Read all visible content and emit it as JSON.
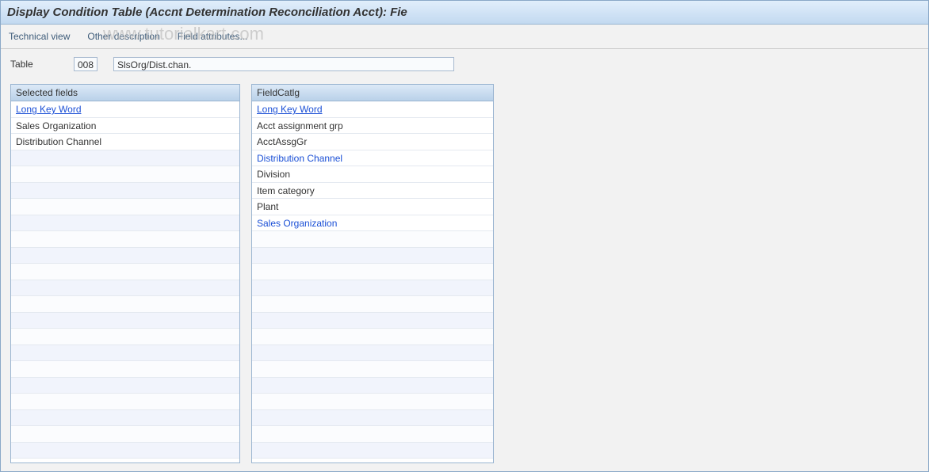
{
  "header": {
    "title": "Display Condition Table (Accnt Determination Reconciliation Acct): Fie"
  },
  "menu": {
    "items": [
      "Technical view",
      "Other description",
      "Field attributes..."
    ]
  },
  "table_field": {
    "label": "Table",
    "code": "008",
    "desc": "SlsOrg/Dist.chan."
  },
  "panels": {
    "selected": {
      "title": "Selected fields",
      "header_row": "Long Key Word",
      "rows": [
        "Sales Organization",
        "Distribution Channel"
      ]
    },
    "catalog": {
      "title": "FieldCatlg",
      "header_row": "Long Key Word",
      "rows": [
        {
          "label": "Acct assignment grp",
          "link": false
        },
        {
          "label": "AcctAssgGr",
          "link": false
        },
        {
          "label": "Distribution Channel",
          "link": true
        },
        {
          "label": "Division",
          "link": false
        },
        {
          "label": "Item category",
          "link": false
        },
        {
          "label": "Plant",
          "link": false
        },
        {
          "label": "Sales Organization",
          "link": true
        }
      ]
    }
  },
  "watermark": "www.tutorialkart.com"
}
